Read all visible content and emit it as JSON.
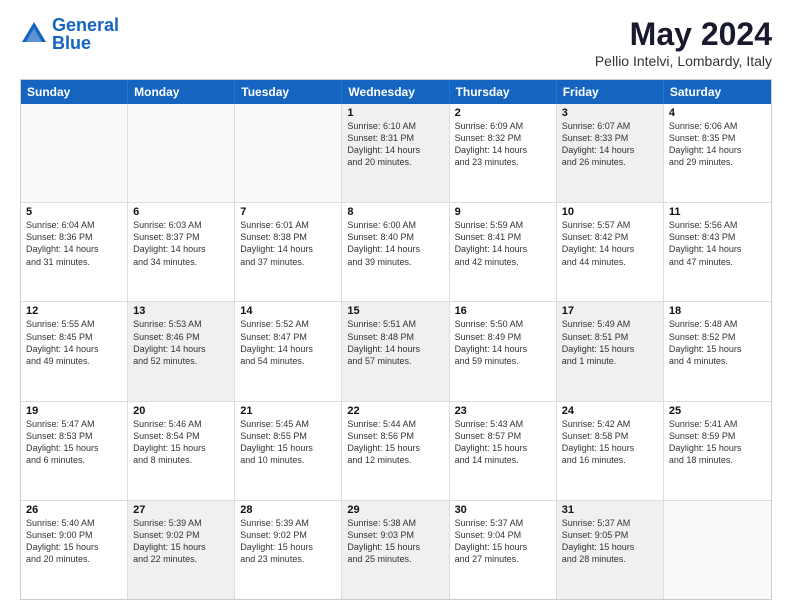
{
  "header": {
    "logo_line1": "General",
    "logo_line2": "Blue",
    "month": "May 2024",
    "location": "Pellio Intelvi, Lombardy, Italy"
  },
  "weekdays": [
    "Sunday",
    "Monday",
    "Tuesday",
    "Wednesday",
    "Thursday",
    "Friday",
    "Saturday"
  ],
  "rows": [
    [
      {
        "day": "",
        "text": "",
        "empty": true
      },
      {
        "day": "",
        "text": "",
        "empty": true
      },
      {
        "day": "",
        "text": "",
        "empty": true
      },
      {
        "day": "1",
        "text": "Sunrise: 6:10 AM\nSunset: 8:31 PM\nDaylight: 14 hours\nand 20 minutes."
      },
      {
        "day": "2",
        "text": "Sunrise: 6:09 AM\nSunset: 8:32 PM\nDaylight: 14 hours\nand 23 minutes."
      },
      {
        "day": "3",
        "text": "Sunrise: 6:07 AM\nSunset: 8:33 PM\nDaylight: 14 hours\nand 26 minutes."
      },
      {
        "day": "4",
        "text": "Sunrise: 6:06 AM\nSunset: 8:35 PM\nDaylight: 14 hours\nand 29 minutes."
      }
    ],
    [
      {
        "day": "5",
        "text": "Sunrise: 6:04 AM\nSunset: 8:36 PM\nDaylight: 14 hours\nand 31 minutes."
      },
      {
        "day": "6",
        "text": "Sunrise: 6:03 AM\nSunset: 8:37 PM\nDaylight: 14 hours\nand 34 minutes."
      },
      {
        "day": "7",
        "text": "Sunrise: 6:01 AM\nSunset: 8:38 PM\nDaylight: 14 hours\nand 37 minutes."
      },
      {
        "day": "8",
        "text": "Sunrise: 6:00 AM\nSunset: 8:40 PM\nDaylight: 14 hours\nand 39 minutes."
      },
      {
        "day": "9",
        "text": "Sunrise: 5:59 AM\nSunset: 8:41 PM\nDaylight: 14 hours\nand 42 minutes."
      },
      {
        "day": "10",
        "text": "Sunrise: 5:57 AM\nSunset: 8:42 PM\nDaylight: 14 hours\nand 44 minutes."
      },
      {
        "day": "11",
        "text": "Sunrise: 5:56 AM\nSunset: 8:43 PM\nDaylight: 14 hours\nand 47 minutes."
      }
    ],
    [
      {
        "day": "12",
        "text": "Sunrise: 5:55 AM\nSunset: 8:45 PM\nDaylight: 14 hours\nand 49 minutes."
      },
      {
        "day": "13",
        "text": "Sunrise: 5:53 AM\nSunset: 8:46 PM\nDaylight: 14 hours\nand 52 minutes."
      },
      {
        "day": "14",
        "text": "Sunrise: 5:52 AM\nSunset: 8:47 PM\nDaylight: 14 hours\nand 54 minutes."
      },
      {
        "day": "15",
        "text": "Sunrise: 5:51 AM\nSunset: 8:48 PM\nDaylight: 14 hours\nand 57 minutes."
      },
      {
        "day": "16",
        "text": "Sunrise: 5:50 AM\nSunset: 8:49 PM\nDaylight: 14 hours\nand 59 minutes."
      },
      {
        "day": "17",
        "text": "Sunrise: 5:49 AM\nSunset: 8:51 PM\nDaylight: 15 hours\nand 1 minute."
      },
      {
        "day": "18",
        "text": "Sunrise: 5:48 AM\nSunset: 8:52 PM\nDaylight: 15 hours\nand 4 minutes."
      }
    ],
    [
      {
        "day": "19",
        "text": "Sunrise: 5:47 AM\nSunset: 8:53 PM\nDaylight: 15 hours\nand 6 minutes."
      },
      {
        "day": "20",
        "text": "Sunrise: 5:46 AM\nSunset: 8:54 PM\nDaylight: 15 hours\nand 8 minutes."
      },
      {
        "day": "21",
        "text": "Sunrise: 5:45 AM\nSunset: 8:55 PM\nDaylight: 15 hours\nand 10 minutes."
      },
      {
        "day": "22",
        "text": "Sunrise: 5:44 AM\nSunset: 8:56 PM\nDaylight: 15 hours\nand 12 minutes."
      },
      {
        "day": "23",
        "text": "Sunrise: 5:43 AM\nSunset: 8:57 PM\nDaylight: 15 hours\nand 14 minutes."
      },
      {
        "day": "24",
        "text": "Sunrise: 5:42 AM\nSunset: 8:58 PM\nDaylight: 15 hours\nand 16 minutes."
      },
      {
        "day": "25",
        "text": "Sunrise: 5:41 AM\nSunset: 8:59 PM\nDaylight: 15 hours\nand 18 minutes."
      }
    ],
    [
      {
        "day": "26",
        "text": "Sunrise: 5:40 AM\nSunset: 9:00 PM\nDaylight: 15 hours\nand 20 minutes."
      },
      {
        "day": "27",
        "text": "Sunrise: 5:39 AM\nSunset: 9:02 PM\nDaylight: 15 hours\nand 22 minutes."
      },
      {
        "day": "28",
        "text": "Sunrise: 5:39 AM\nSunset: 9:02 PM\nDaylight: 15 hours\nand 23 minutes."
      },
      {
        "day": "29",
        "text": "Sunrise: 5:38 AM\nSunset: 9:03 PM\nDaylight: 15 hours\nand 25 minutes."
      },
      {
        "day": "30",
        "text": "Sunrise: 5:37 AM\nSunset: 9:04 PM\nDaylight: 15 hours\nand 27 minutes."
      },
      {
        "day": "31",
        "text": "Sunrise: 5:37 AM\nSunset: 9:05 PM\nDaylight: 15 hours\nand 28 minutes."
      },
      {
        "day": "",
        "text": "",
        "empty": true
      }
    ]
  ]
}
